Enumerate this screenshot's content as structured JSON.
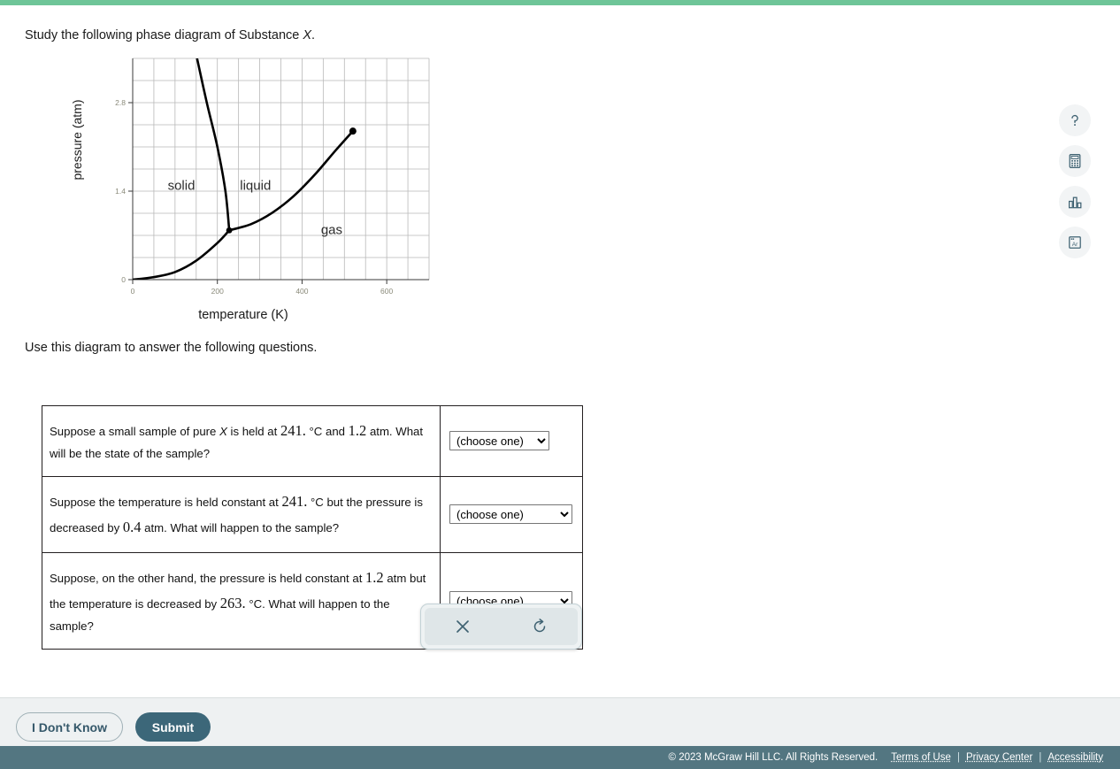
{
  "page": {
    "prompt_top_prefix": "Study the following phase diagram of Substance ",
    "prompt_top_italic": "X",
    "prompt_top_suffix": ".",
    "prompt_mid": "Use this diagram to answer the following questions."
  },
  "chart_data": {
    "type": "line",
    "title": "",
    "xlabel": "temperature (K)",
    "ylabel": "pressure  (atm)",
    "xlim": [
      0,
      700
    ],
    "ylim": [
      0,
      3.5
    ],
    "xticks": [
      0,
      200,
      400,
      600
    ],
    "xticklabels": [
      "0",
      "200",
      "400",
      "600"
    ],
    "yticks": [
      0,
      1.4,
      2.8
    ],
    "yticklabels": [
      "0",
      "1.4",
      "2.8"
    ],
    "grid": true,
    "grid_step_x": 50,
    "grid_step_y": 0.35,
    "region_labels": [
      {
        "text": "solid",
        "x": 115,
        "y": 1.42
      },
      {
        "text": "liquid",
        "x": 290,
        "y": 1.42
      },
      {
        "text": "gas",
        "x": 470,
        "y": 0.72
      }
    ],
    "series": [
      {
        "name": "sublimation-curve",
        "points": [
          [
            0,
            0.0
          ],
          [
            50,
            0.04
          ],
          [
            100,
            0.12
          ],
          [
            150,
            0.3
          ],
          [
            200,
            0.58
          ],
          [
            228,
            0.78
          ]
        ]
      },
      {
        "name": "fusion-curve",
        "points": [
          [
            228,
            0.78
          ],
          [
            219,
            1.4
          ],
          [
            200,
            2.1
          ],
          [
            175,
            2.8
          ],
          [
            152,
            3.5
          ]
        ]
      },
      {
        "name": "vaporization-curve",
        "points": [
          [
            228,
            0.78
          ],
          [
            280,
            0.88
          ],
          [
            330,
            1.06
          ],
          [
            380,
            1.32
          ],
          [
            430,
            1.66
          ],
          [
            480,
            2.05
          ],
          [
            520,
            2.35
          ]
        ]
      }
    ],
    "annotations": [
      {
        "name": "triple-point",
        "x": 228,
        "y": 0.78
      },
      {
        "name": "critical-point",
        "x": 520,
        "y": 2.35
      }
    ]
  },
  "questions": [
    {
      "id": "q1",
      "parts": [
        {
          "t": "Suppose a small sample of pure ",
          "s": "plain"
        },
        {
          "t": "X",
          "s": "ital"
        },
        {
          "t": " is held at ",
          "s": "plain"
        },
        {
          "t": "241.",
          "s": "num"
        },
        {
          "t": " °C and ",
          "s": "plain"
        },
        {
          "t": "1.2",
          "s": "num"
        },
        {
          "t": " atm. What will be the state of the sample?",
          "s": "plain"
        }
      ],
      "select": {
        "value": "(choose one)",
        "options": [
          "(choose one)"
        ],
        "width": "narrow"
      }
    },
    {
      "id": "q2",
      "parts": [
        {
          "t": "Suppose the temperature is held constant at ",
          "s": "plain"
        },
        {
          "t": "241.",
          "s": "num"
        },
        {
          "t": " °C but the pressure is decreased by ",
          "s": "plain"
        },
        {
          "t": "0.4",
          "s": "num"
        },
        {
          "t": " atm. What will happen to the sample?",
          "s": "plain"
        }
      ],
      "select": {
        "value": "(choose one)",
        "options": [
          "(choose one)"
        ],
        "width": "wide"
      }
    },
    {
      "id": "q3",
      "parts": [
        {
          "t": "Suppose, on the other hand, the pressure is held constant at ",
          "s": "plain"
        },
        {
          "t": "1.2",
          "s": "num"
        },
        {
          "t": " atm but the temperature is decreased by ",
          "s": "plain"
        },
        {
          "t": "263.",
          "s": "num"
        },
        {
          "t": " °C. What will happen to the sample?",
          "s": "plain"
        }
      ],
      "select": {
        "value": "(choose one)",
        "options": [
          "(choose one)"
        ],
        "width": "wide"
      }
    }
  ],
  "floatbar": {
    "clear_icon": "close-icon",
    "reset_icon": "reset-icon"
  },
  "toolrail": {
    "items": [
      {
        "name": "help-tool",
        "icon": "question-mark-icon",
        "label": "?"
      },
      {
        "name": "calculator-tool",
        "icon": "calculator-icon",
        "label": ""
      },
      {
        "name": "chart-tool",
        "icon": "bar-chart-icon",
        "label": ""
      },
      {
        "name": "periodic-table-tool",
        "icon": "periodic-table-icon",
        "label": "Ar"
      }
    ]
  },
  "actions": {
    "dont_know_label": "I Don't Know",
    "submit_label": "Submit"
  },
  "footer": {
    "copyright": "© 2023 McGraw Hill LLC. All Rights Reserved.",
    "links": [
      "Terms of Use",
      "Privacy Center",
      "Accessibility"
    ],
    "separator": "|"
  },
  "colors": {
    "accent_top": "#6ec598",
    "submit_bg": "#3c6779",
    "footer_bg": "#537681",
    "tool_icon": "#3f6272"
  }
}
